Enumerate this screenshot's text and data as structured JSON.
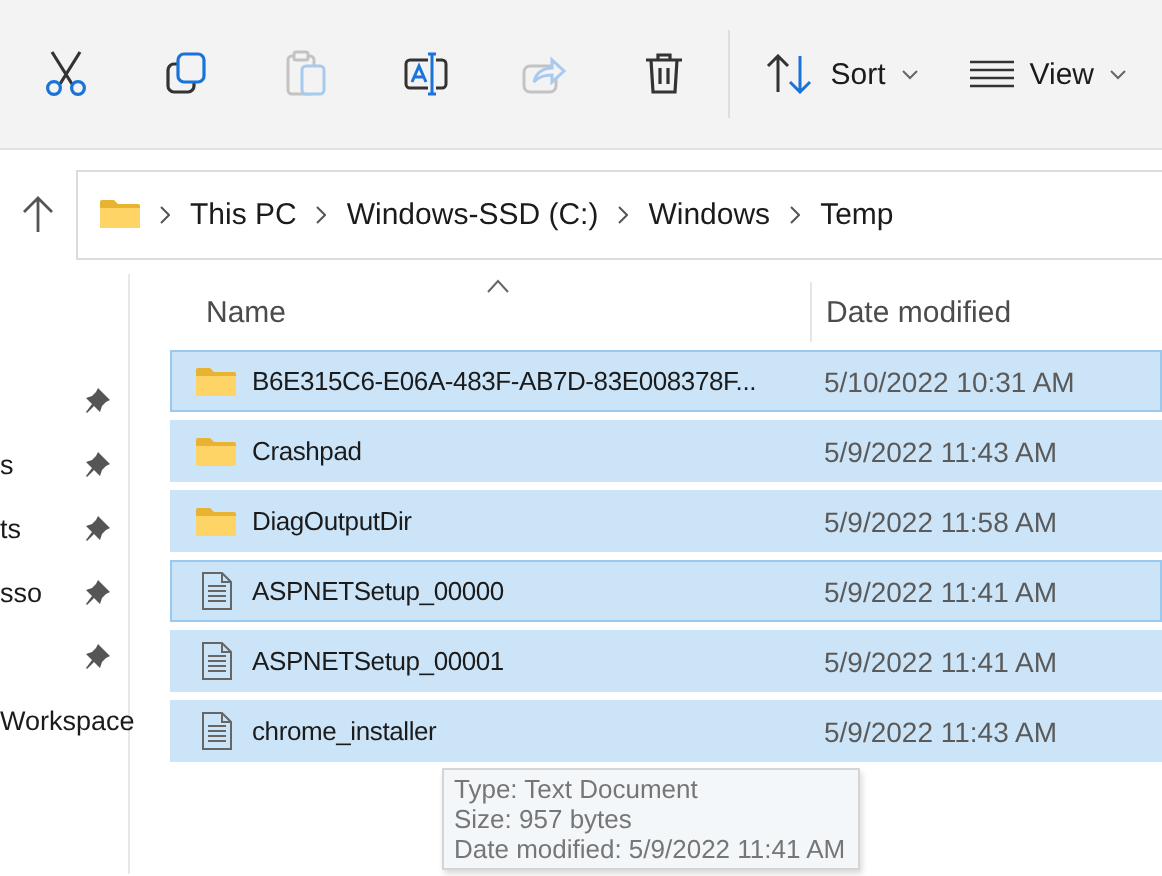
{
  "toolbar": {
    "actions": [
      {
        "kind": "cut",
        "disabled": false
      },
      {
        "kind": "copy",
        "disabled": false
      },
      {
        "kind": "paste",
        "disabled": true
      },
      {
        "kind": "rename",
        "disabled": false
      },
      {
        "kind": "share",
        "disabled": true
      },
      {
        "kind": "delete",
        "disabled": false
      }
    ],
    "menus": [
      {
        "kind": "sort",
        "label": "Sort"
      },
      {
        "kind": "view",
        "label": "View"
      }
    ]
  },
  "address": {
    "path": [
      "This PC",
      "Windows-SSD (C:)",
      "Windows",
      "Temp"
    ]
  },
  "sidebar": {
    "items": [
      {
        "pinned": true
      },
      {
        "label": "s",
        "pinned": true
      },
      {
        "label": "ts",
        "pinned": true
      },
      {
        "label": "sso",
        "pinned": true
      },
      {
        "pinned": true
      },
      {
        "label": "Workspace",
        "pinned": false
      }
    ]
  },
  "table": {
    "columns": [
      {
        "label": "Name",
        "sorted": true
      },
      {
        "label": "Date modified",
        "sorted": false
      }
    ],
    "rows": [
      {
        "kind": "folder",
        "name": "B6E315C6-E06A-483F-AB7D-83E008378F...",
        "date": "5/10/2022 10:31 AM",
        "selected": true,
        "focused": true
      },
      {
        "kind": "folder",
        "name": "Crashpad",
        "date": "5/9/2022 11:43 AM",
        "selected": true,
        "focused": false
      },
      {
        "kind": "folder",
        "name": "DiagOutputDir",
        "date": "5/9/2022 11:58 AM",
        "selected": true,
        "focused": false
      },
      {
        "kind": "file",
        "name": "ASPNETSetup_00000",
        "date": "5/9/2022 11:41 AM",
        "selected": true,
        "focused": true
      },
      {
        "kind": "file",
        "name": "ASPNETSetup_00001",
        "date": "5/9/2022 11:41 AM",
        "selected": true,
        "focused": false
      },
      {
        "kind": "file",
        "name": "chrome_installer",
        "date": "5/9/2022 11:43 AM",
        "selected": true,
        "focused": false
      }
    ]
  },
  "tooltip": {
    "lines": [
      "Type: Text Document",
      "Size: 957 bytes",
      "Date modified: 5/9/2022 11:41 AM"
    ]
  }
}
